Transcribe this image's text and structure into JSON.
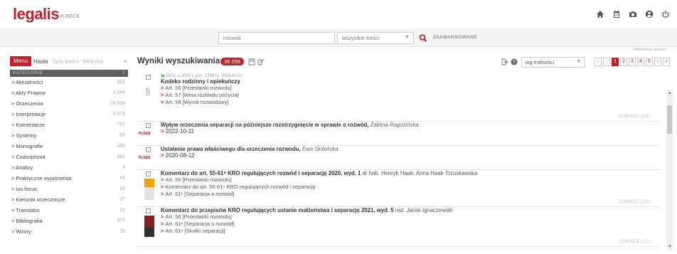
{
  "brand": {
    "logo": "legalis",
    "sub": "C.H.BECK"
  },
  "top_icons": [
    "home-icon",
    "calendar-icon",
    "camera-icon",
    "user-icon",
    "power-icon"
  ],
  "search": {
    "value": "rozwód",
    "scope": "wszystkie treści",
    "advanced": "ZAAWANSOWANE"
  },
  "sidebar": {
    "tabs": {
      "menu": "Menu",
      "hasla": "Hasła",
      "spis": "Spis treści",
      "metryka": "Metryka"
    },
    "header": {
      "label": "KATEGORIE",
      "count": "2"
    },
    "items": [
      {
        "label": "> Aktualności",
        "count": "352"
      },
      {
        "label": "> Akty Prawne",
        "count": "1 045"
      },
      {
        "label": "> Orzeczenia",
        "count": "29 588"
      },
      {
        "label": "> Interpretacje",
        "count": "3 073"
      },
      {
        "label": "> Komentarze",
        "count": "757"
      },
      {
        "label": "> Systemy",
        "count": "65"
      },
      {
        "label": "> Monografie",
        "count": "435"
      },
      {
        "label": "> Czasopisma",
        "count": "441"
      },
      {
        "label": "> Analizy",
        "count": "4"
      },
      {
        "label": "> Praktyczne wyjaśnienia",
        "count": "44"
      },
      {
        "label": "> ius.focus",
        "count": "14"
      },
      {
        "label": "> Kierunki orzecznicze",
        "count": "27"
      },
      {
        "label": "> Translator",
        "count": "11"
      },
      {
        "label": "> Bibliografia",
        "count": "377"
      },
      {
        "label": "> Wzory",
        "count": "25"
      }
    ]
  },
  "main": {
    "hint": "Widok lista wariant",
    "title": "Wyniki wyszukiwania",
    "count": "36 258",
    "sort": "wg trafności",
    "pages": [
      "«",
      "‹",
      "1",
      "2",
      "3",
      "4",
      "5",
      "›",
      "»"
    ]
  },
  "results": [
    {
      "meta": "Dz.U. z 2020 r. poz. 1359 t.j.   2023.02.01 -",
      "title": "Kodeks rodzinny i opiekuńczy",
      "links": [
        "Art. 56 [Przesłanki rozwodu]",
        "Art. 57 [Wina rozkładu pożycia]",
        "Art. 58 [Wyrok rozwodowy]"
      ],
      "zobacz": "ZOBACZ (24)"
    },
    {
      "badge": "n.ius",
      "title": "Wpływ orzeczenia separacji na późniejsze rozstrzygnięcie w sprawie o rozwód,",
      "author": "Zaklina Rogozińska",
      "date": "2022-10-11"
    },
    {
      "badge": "n.ius",
      "title": "Ustalenie prawa właściwego dla orzeczenia rozwodu,",
      "author": "Ewa Skibińska",
      "date": "2020-08-12"
    },
    {
      "title": "Komentarz do art. 55-61⁶ KRO regulujących rozwód i separację 2020, wyd. 1",
      "author": "dr hab. Henryk Haak, Anna Haak-Trzuskawska",
      "links": [
        "Art. 56 [Przesłanki rozwodu]",
        "Komentarz do art. 55-61⁶ KRO regulujących rozwód i separację",
        "Art. 61¹ [Separacja a rozwód]"
      ],
      "zobacz": "ZOBACZ (13)"
    },
    {
      "title": "Komentarz do przepisów KRO regulujących ustanie małżeństwa i separację 2021, wyd. 5",
      "author": "red. Jacek Ignaczewski",
      "links": [
        "Art. 56 [Przesłanki rozwodu]",
        "Art. 61² [Separacja a rozwód]",
        "Art. 61⁴ [Skutki separacji]"
      ],
      "zobacz": "ZOBACZ (11)"
    }
  ],
  "colors": {
    "accent": "#c0202a",
    "sidebar_header": "#5e5e5e",
    "meta_green": "#4caf50"
  }
}
